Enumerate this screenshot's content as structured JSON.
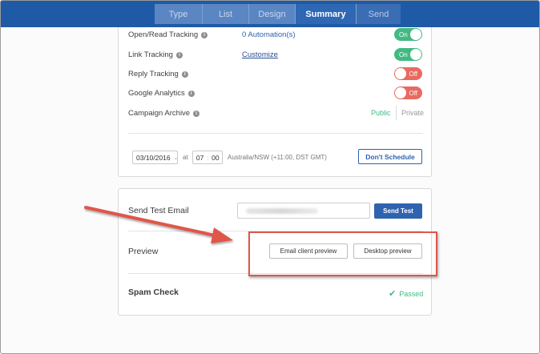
{
  "wizard": {
    "steps": [
      {
        "label": "Type"
      },
      {
        "label": "List"
      },
      {
        "label": "Design"
      },
      {
        "label": "Summary"
      },
      {
        "label": "Send"
      }
    ],
    "active_index": 3
  },
  "settings": {
    "open_tracking": {
      "label": "Open/Read Tracking",
      "link": "0 Automation(s)",
      "toggle": "On"
    },
    "link_tracking": {
      "label": "Link Tracking",
      "link": "Customize",
      "toggle": "On"
    },
    "reply_tracking": {
      "label": "Reply Tracking",
      "toggle": "Off"
    },
    "google_analytics": {
      "label": "Google Analytics",
      "toggle": "Off"
    },
    "campaign_archive": {
      "label": "Campaign Archive",
      "public": "Public",
      "private": "Private"
    }
  },
  "schedule": {
    "date": "03/10/2016",
    "at_label": "at",
    "hour": "07",
    "minute": "00",
    "timezone": "Australia/NSW (+11:00, DST GMT)",
    "dont_schedule_label": "Don't Schedule"
  },
  "test_email": {
    "title": "Send Test Email",
    "button_label": "Send Test"
  },
  "preview": {
    "title": "Preview",
    "email_client_label": "Email client preview",
    "desktop_label": "Desktop preview"
  },
  "spam": {
    "title": "Spam Check",
    "status": "Passed"
  },
  "colors": {
    "topbar": "#1f5aa6",
    "accent": "#2f63b0",
    "success": "#42b983",
    "danger": "#e86a60",
    "annotation": "#e0574a"
  }
}
